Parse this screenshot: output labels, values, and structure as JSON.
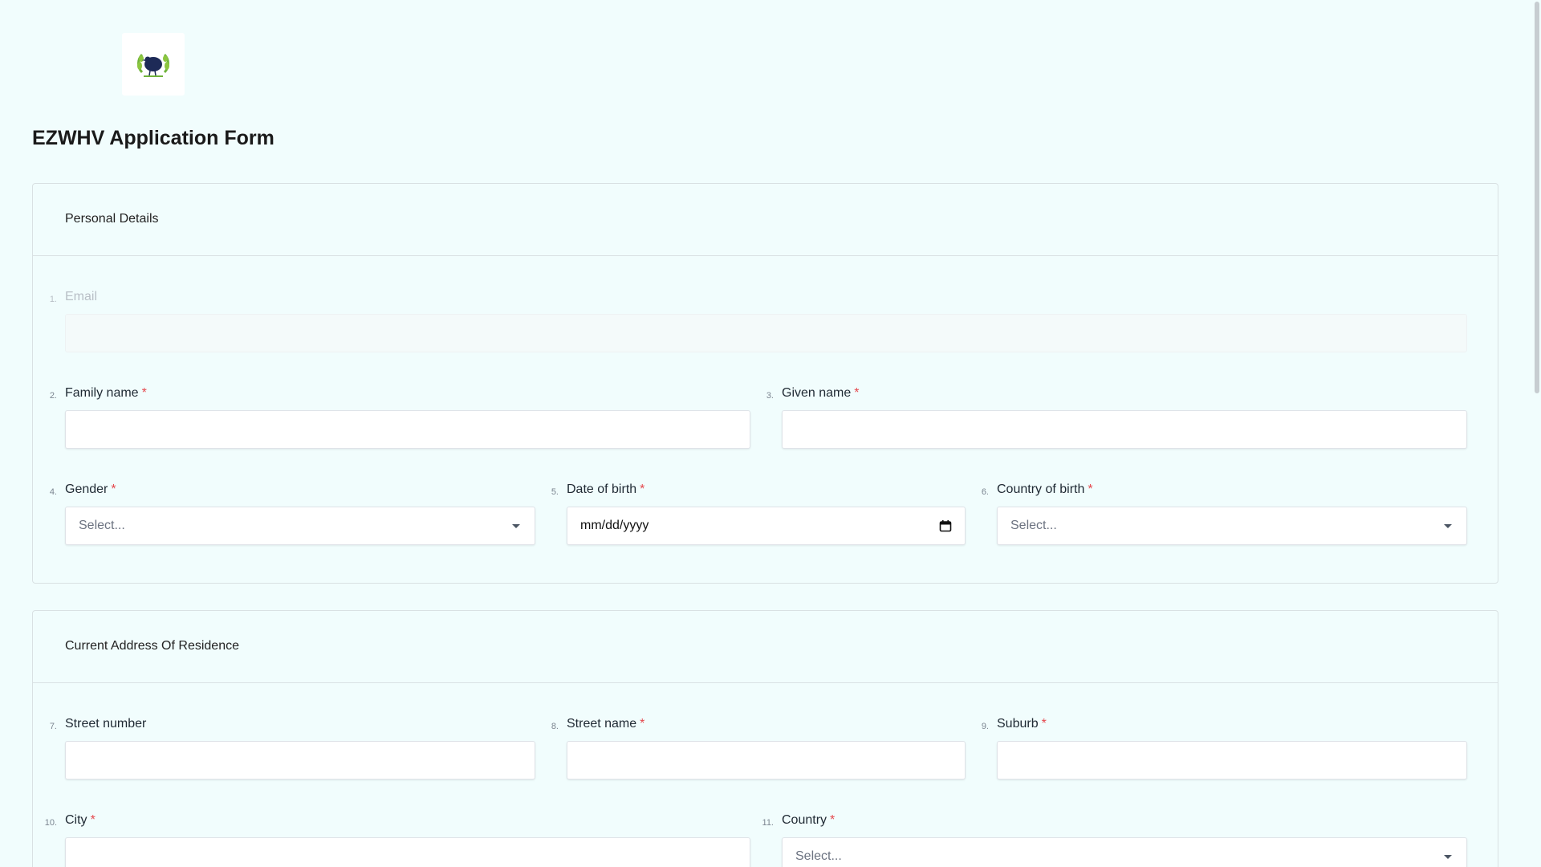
{
  "form": {
    "title": "EZWHV Application Form"
  },
  "sections": [
    {
      "title": "Personal Details",
      "fields": [
        {
          "num": "1.",
          "label": "Email",
          "required": false
        },
        {
          "num": "2.",
          "label": "Family name",
          "required": true
        },
        {
          "num": "3.",
          "label": "Given name",
          "required": true
        },
        {
          "num": "4.",
          "label": "Gender",
          "required": true,
          "placeholder": "Select..."
        },
        {
          "num": "5.",
          "label": "Date of birth",
          "required": true,
          "placeholder": "mm/dd/yyyy"
        },
        {
          "num": "6.",
          "label": "Country of birth",
          "required": true,
          "placeholder": "Select..."
        }
      ]
    },
    {
      "title": "Current Address Of Residence",
      "fields": [
        {
          "num": "7.",
          "label": "Street number",
          "required": false
        },
        {
          "num": "8.",
          "label": "Street name",
          "required": true
        },
        {
          "num": "9.",
          "label": "Suburb",
          "required": true
        },
        {
          "num": "10.",
          "label": "City",
          "required": true
        },
        {
          "num": "11.",
          "label": "Country",
          "required": true,
          "placeholder": "Select..."
        }
      ]
    }
  ],
  "required_marker": "*",
  "colors": {
    "background": "#f1fdfd",
    "required": "#e5484d",
    "logo_green": "#6fb33a",
    "logo_navy": "#1d2a57"
  },
  "icons": {
    "logo": "laurel-bird-logo",
    "dropdown": "caret-down-icon",
    "date": "calendar-icon"
  }
}
